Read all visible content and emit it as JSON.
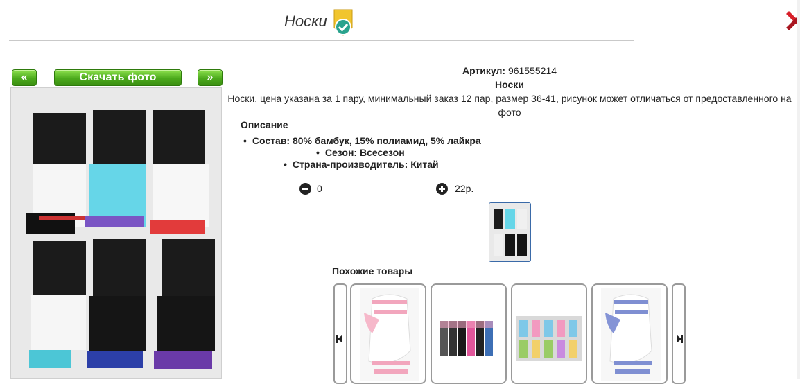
{
  "page": {
    "title": "Носки"
  },
  "nav": {
    "prev_label": "«",
    "next_label": "»",
    "download_label": "Скачать фото"
  },
  "product": {
    "article_label": "Артикул:",
    "article_value": "961555214",
    "name": "Носки",
    "summary": "Носки, цена указана за 1 пару, минимальный заказ 12 пар, размер 36-41, рисунок может отличаться от предоставленного на фото",
    "description_heading": "Описание",
    "features": [
      "Состав: 80% бамбук, 15% полиамид, 5% лайкра",
      "Сезон: Всесезон",
      "Страна-производитель: Китай"
    ],
    "quantity": "0",
    "price": "22р."
  },
  "similar": {
    "heading": "Похожие товары"
  },
  "icons": [
    "verified-badge-icon",
    "close-icon",
    "minus-icon",
    "plus-icon",
    "arrow-left-icon",
    "arrow-right-icon"
  ],
  "colors": {
    "accent_green": "#4caa1c",
    "close_red": "#d8202a",
    "thumb_border": "#3a6aa8"
  }
}
